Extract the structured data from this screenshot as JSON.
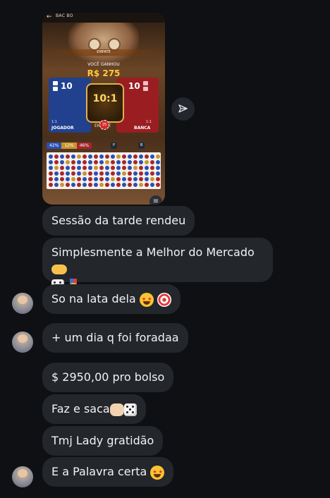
{
  "game_screenshot": {
    "header_title": "BAC BO",
    "banner": "EMPATE",
    "win_label": "VOCÊ GANHOU",
    "win_amount": "R$ 275",
    "player_score": "10",
    "banker_score": "10",
    "payout": "10:1",
    "chip_value": "25",
    "center_label": "EMPATE",
    "player_ratio": "1:1",
    "banker_ratio": "1:1",
    "player_label": "JOGADOR",
    "banker_label": "BANCA",
    "stats": {
      "player_pct": "42%",
      "tie_pct": "12%",
      "banker_pct": "46%"
    },
    "predict_player": "P",
    "predict_banker": "B",
    "colors": {
      "player": "#2850b5",
      "banker": "#a7262b",
      "tie": "#c9962e"
    }
  },
  "messages": [
    {
      "text": "Sessão da tarde rendeu",
      "emoji": []
    },
    {
      "text": "Simplesmente a Melhor do Mercado",
      "emoji": [
        "point-left-icon",
        "dice-icon",
        "medal-icon"
      ]
    },
    {
      "text": "So na lata dela",
      "emoji": [
        "star-struck-icon",
        "target-icon"
      ]
    },
    {
      "text": "+ um dia q foi foradaa",
      "emoji": []
    },
    {
      "text": "$ 2950,00 pro bolso",
      "emoji": []
    },
    {
      "text": "Faz e saca",
      "emoji": [
        "clap-icon",
        "dice-icon"
      ]
    },
    {
      "text": "Tmj Lady gratidão",
      "emoji": []
    },
    {
      "text": "E a Palavra certa",
      "emoji": [
        "star-struck-icon"
      ]
    }
  ],
  "medal_number": "1"
}
